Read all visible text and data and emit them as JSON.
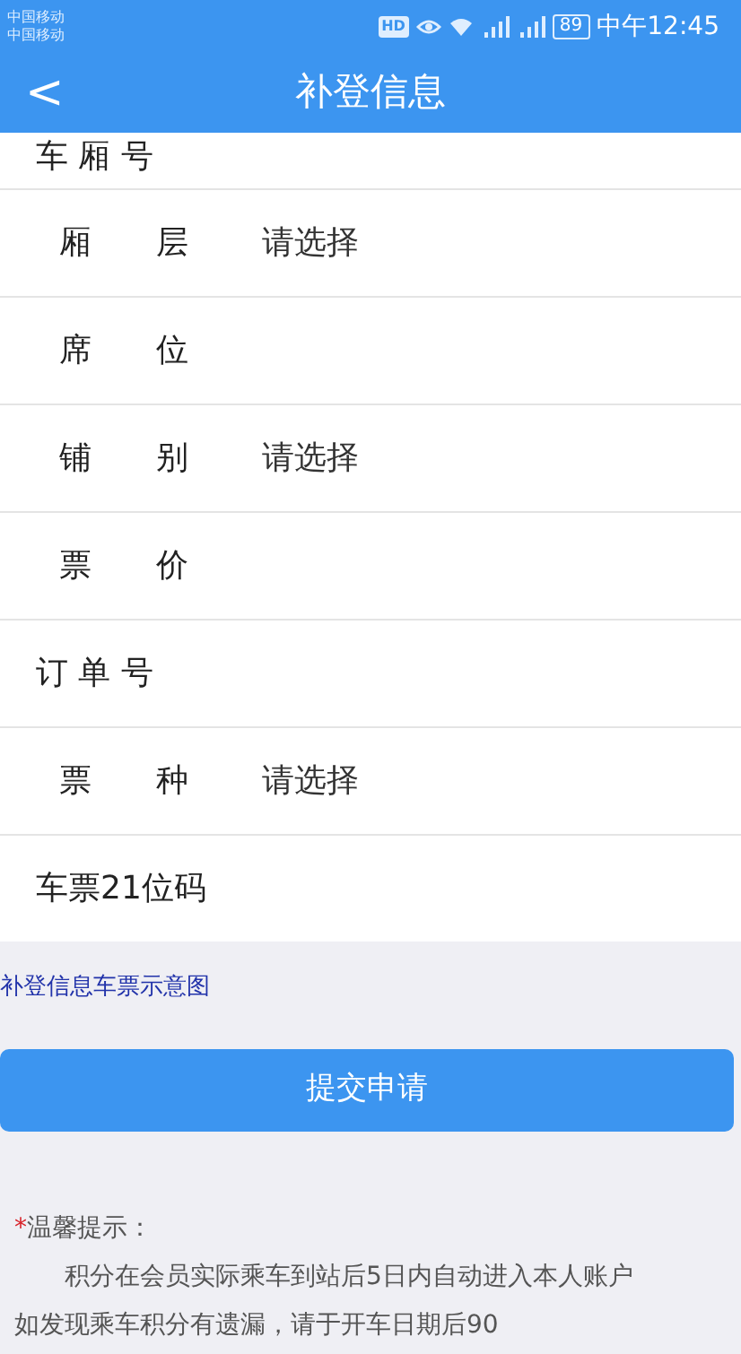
{
  "status_bar": {
    "carriers": [
      "中国移动",
      "中国移动"
    ],
    "hd": "HD",
    "battery": "89",
    "time": "中午12:45"
  },
  "header": {
    "back": "<",
    "title": "补登信息"
  },
  "form_rows": [
    {
      "label": "车 厢 号",
      "kind": "input"
    },
    {
      "label": "厢　　层",
      "kind": "select",
      "placeholder": "请选择"
    },
    {
      "label": "席　　位",
      "kind": "input"
    },
    {
      "label": "铺　　别",
      "kind": "select",
      "placeholder": "请选择"
    },
    {
      "label": "票　　价",
      "kind": "input"
    },
    {
      "label": "订 单 号",
      "kind": "input"
    },
    {
      "label": "票　　种",
      "kind": "select",
      "placeholder": "请选择"
    },
    {
      "label": "车票21位码",
      "kind": "input"
    }
  ],
  "sample_link": "补登信息车票示意图",
  "submit_button": "提交申请",
  "tips": {
    "star": "*",
    "title": "温馨提示：",
    "lines": [
      "积分在会员实际乘车到站后5日内自动进入本人账户",
      "如发现乘车积分有遗漏，请于开车日期后90"
    ]
  }
}
